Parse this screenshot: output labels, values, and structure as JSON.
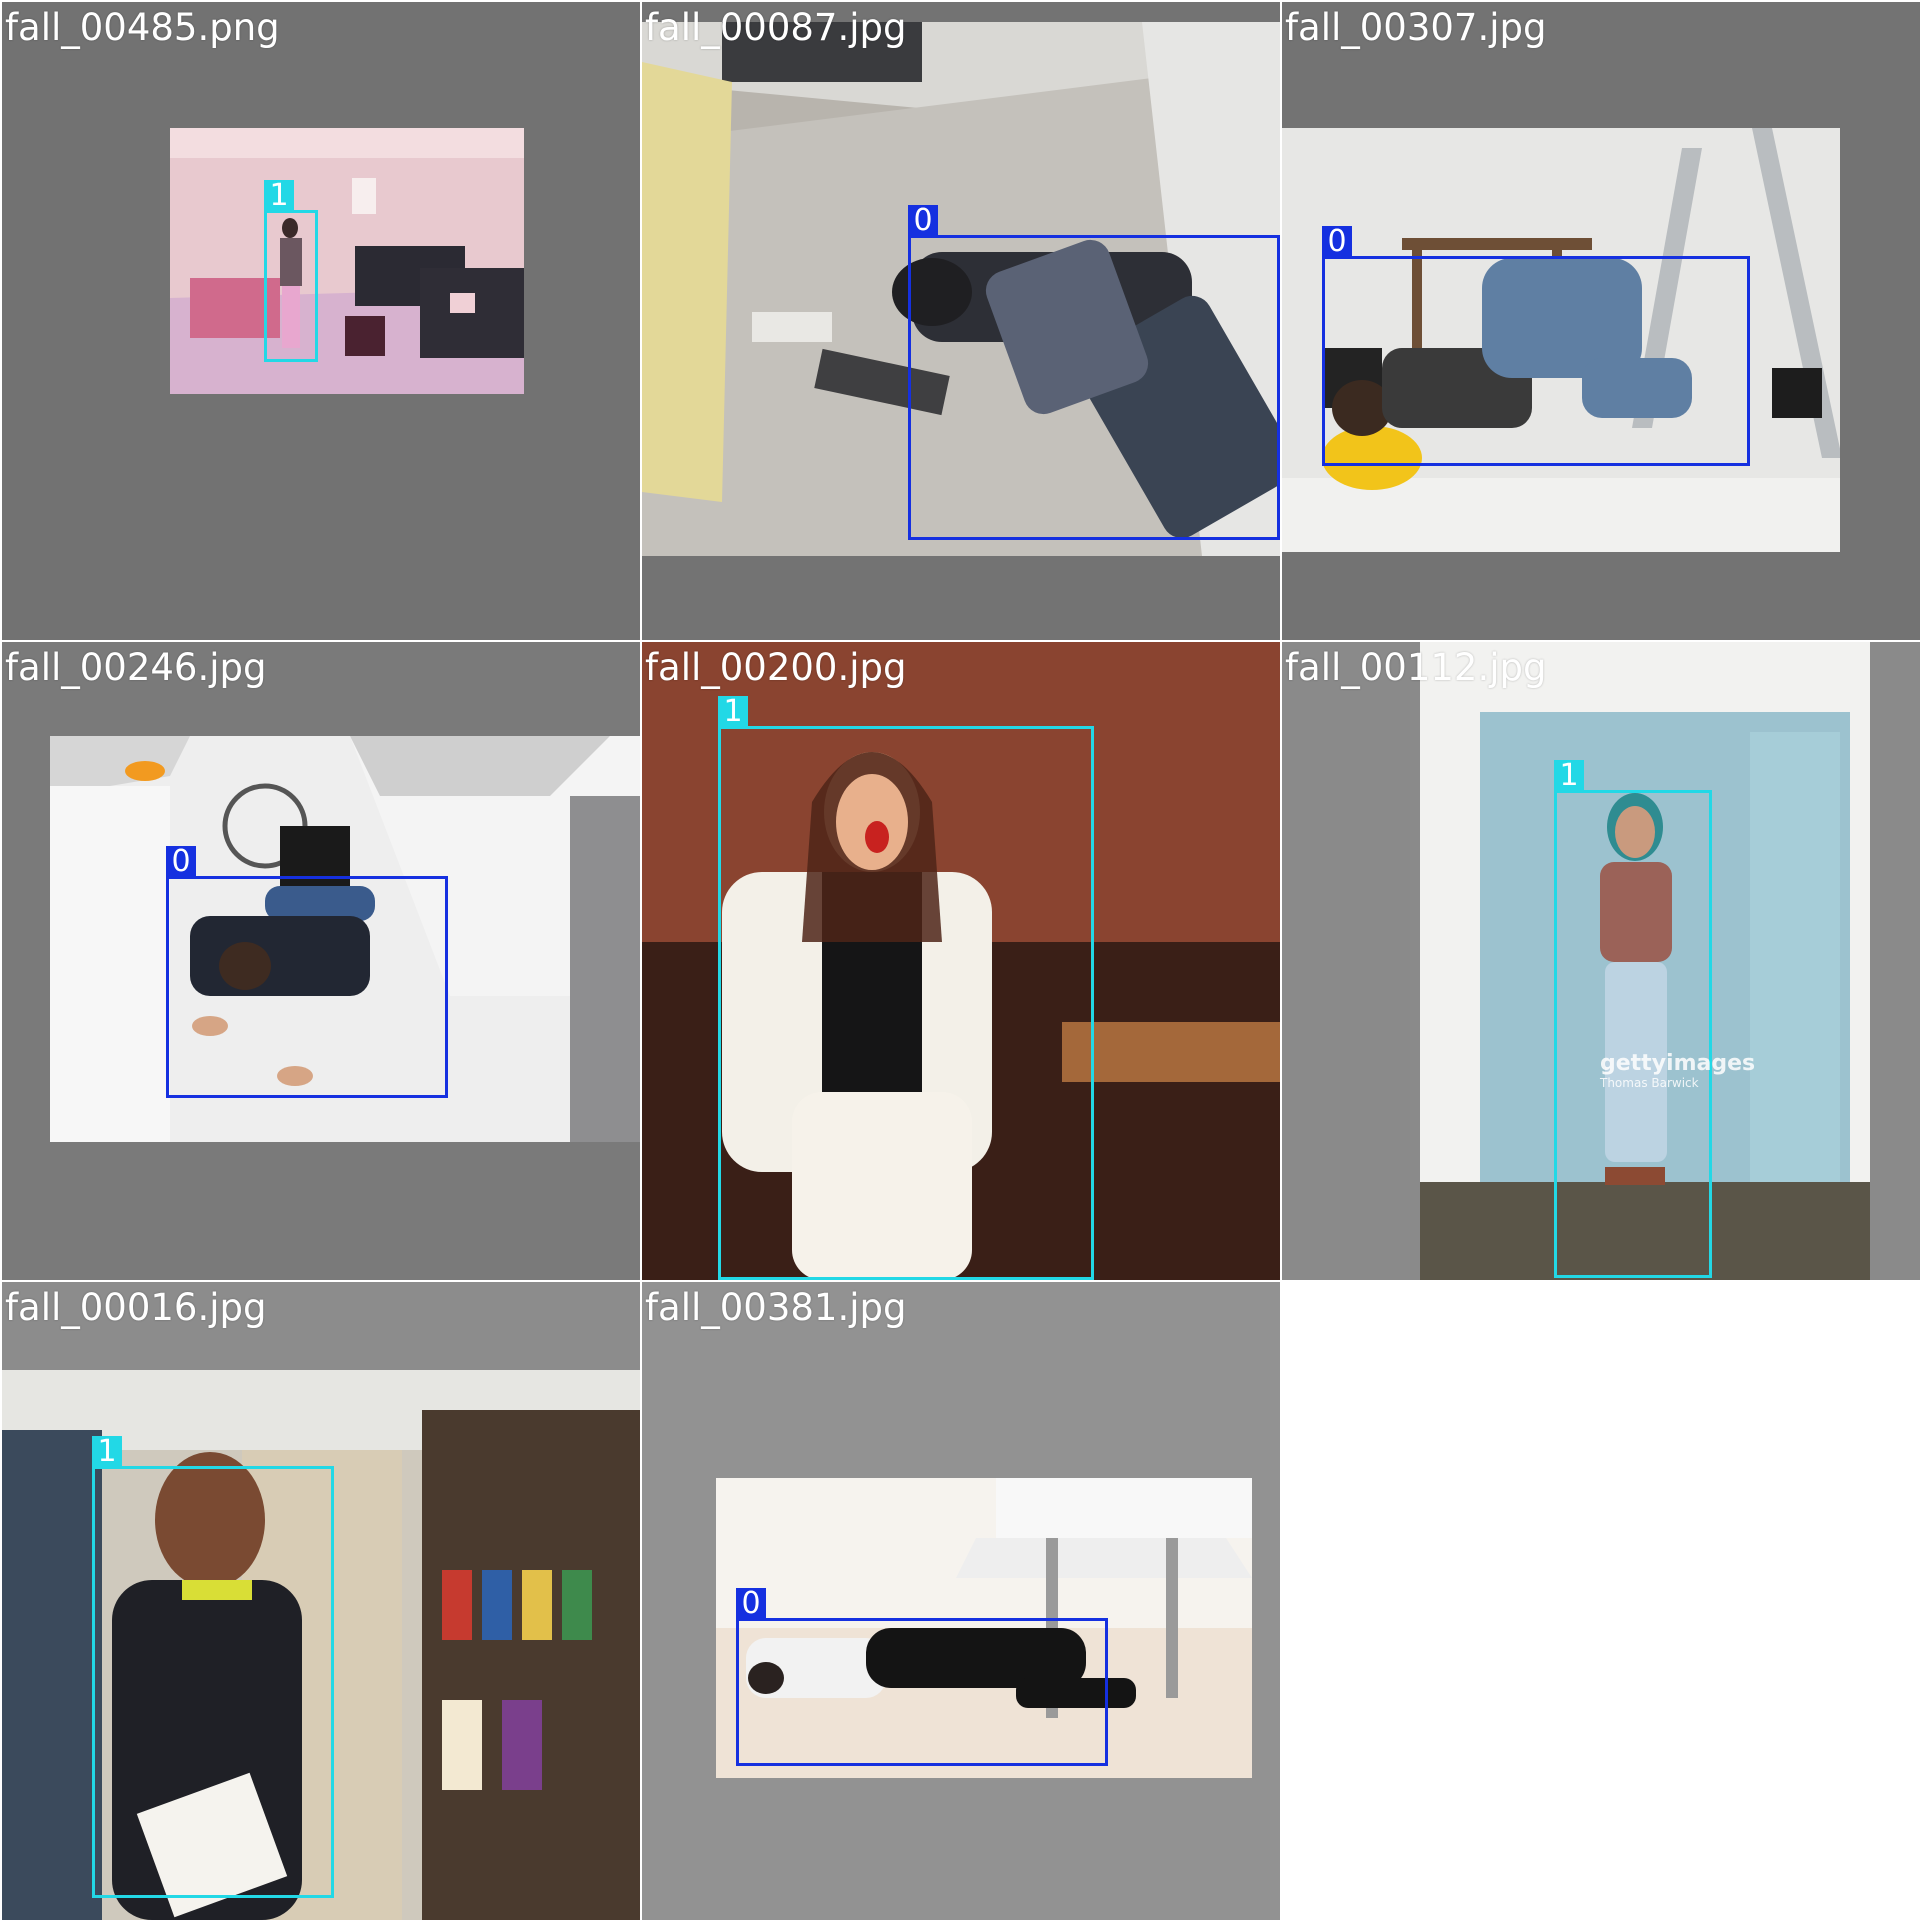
{
  "tiles": [
    {
      "filename": "fall_00485.png",
      "box_label": "1"
    },
    {
      "filename": "fall_00087.jpg",
      "box_label": "0"
    },
    {
      "filename": "fall_00307.jpg",
      "box_label": "0"
    },
    {
      "filename": "fall_00246.jpg",
      "box_label": "0"
    },
    {
      "filename": "fall_00200.jpg",
      "box_label": "1"
    },
    {
      "filename": "fall_00112.jpg",
      "box_label": "1"
    },
    {
      "filename": "fall_00016.jpg",
      "box_label": "1"
    },
    {
      "filename": "fall_00381.jpg",
      "box_label": "0"
    }
  ],
  "watermarks": {
    "tile6": "gettyimages",
    "tile6_sub": "Thomas Barwick"
  },
  "colors": {
    "class_0": "#1530e0",
    "class_1": "#22d8e6",
    "tile_background": "#737373"
  }
}
